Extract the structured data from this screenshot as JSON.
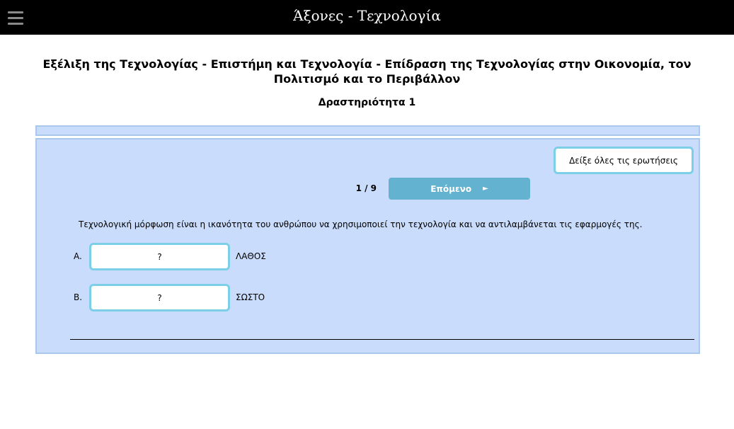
{
  "header": {
    "menu_icon": "hamburger-menu-icon",
    "title": "Άξονες - Τεχνολογία"
  },
  "page": {
    "title": "Εξέλιξη της Τεχνολογίας - Επιστήμη και Τεχνολογία - Επίδραση της Τεχνολογίας στην Οικονομία, τον Πολιτισμό και το Περιβάλλον",
    "activity": "Δραστηριότητα 1"
  },
  "quiz": {
    "show_all_label": "Δείξε όλες τις ερωτήσεις",
    "counter": "1 / 9",
    "next_label": "Επόμενο",
    "next_arrow": "►",
    "question": "Τεχνολογική μόρφωση είναι η ικανότητα του ανθρώπου να χρησιμοποιεί την τεχνολογία και να αντιλαμβάνεται τις εφαρμογές της.",
    "answers": [
      {
        "letter": "A.",
        "slot": "?",
        "text": "ΛΑΘΟΣ"
      },
      {
        "letter": "B.",
        "slot": "?",
        "text": "ΣΩΣΤΟ"
      }
    ]
  },
  "colors": {
    "topbar": "#000000",
    "panel": "#c9dcfb",
    "panel_border": "#a9c8ec",
    "accent_border": "#7ccfe6",
    "next_button": "#63b2cf"
  }
}
